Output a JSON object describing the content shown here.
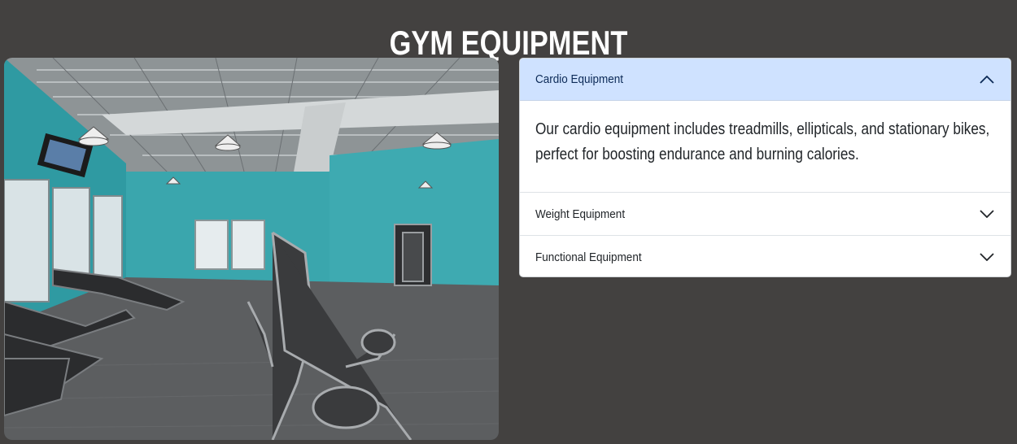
{
  "page": {
    "title": "GYM EQUIPMENT"
  },
  "image": {
    "description_icon": "gym-photo"
  },
  "accordion": {
    "items": [
      {
        "label": "Cardio Equipment",
        "expanded": true,
        "body": "Our cardio equipment includes treadmills, ellipticals, and stationary bikes, perfect for boosting endurance and burning calories."
      },
      {
        "label": "Weight Equipment",
        "expanded": false
      },
      {
        "label": "Functional Equipment",
        "expanded": false
      }
    ]
  },
  "colors": {
    "background": "#434140",
    "active_header": "#cfe2ff",
    "active_text": "#0c2a57",
    "wall_teal": "#3aa6ad"
  }
}
